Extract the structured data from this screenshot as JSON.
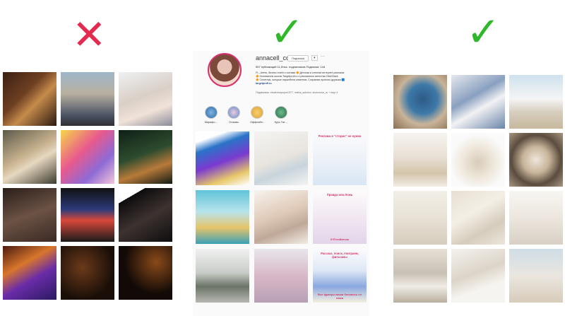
{
  "marks": {
    "bad": "✕",
    "good": "✓",
    "colors": {
      "bad": "#e32a4f",
      "good": "#2fb82a"
    }
  },
  "profile": {
    "username": "annacell_co",
    "follow_button": "Подписка",
    "dropdown": "▾",
    "more": "···",
    "stats": "557 публикаций     11,5тыс. подписчиков     Подписки: 144",
    "bio_line1": "Я – Аптек, бизнес-пчеёл с котами 🔶 Детская и стенная интернет-рекламы",
    "bio_line2": "🔶 Основатель школы Targetprofi.ru и рекламного агенства ClickShark",
    "bio_line3": "🔶 Сплетник, которые пиралбели клиентов. Сохраняю проекты друзьям 🟦",
    "bio_link": "targetprofi.ru",
    "subscribed_by": "Подписаны: ekaterinapopro1977, misha_sokolov, shokorose_ru + еще 4",
    "highlights": [
      "Марафо…",
      "Отзывы",
      "Оффлайн…",
      "Курс Тат…"
    ],
    "cards": [
      {
        "top": "",
        "bottom": ""
      },
      {
        "top": "",
        "bottom": ""
      },
      {
        "top": "Реклама в \"сторис\" не нужна",
        "bottom": ""
      },
      {
        "top": "",
        "bottom": ""
      },
      {
        "top": "",
        "bottom": ""
      },
      {
        "top": "Правда или Ложь",
        "bottom": "Х*Я поймешь"
      },
      {
        "top": "",
        "bottom": ""
      },
      {
        "top": "",
        "bottom": ""
      },
      {
        "top": "Рассказ, поиск, поиграем, фигасамы",
        "bottom": "Все фраеры ваши беновесь сп нами"
      }
    ]
  },
  "feeds": {
    "bad_tile_count": 12,
    "good_tile_count": 12
  }
}
